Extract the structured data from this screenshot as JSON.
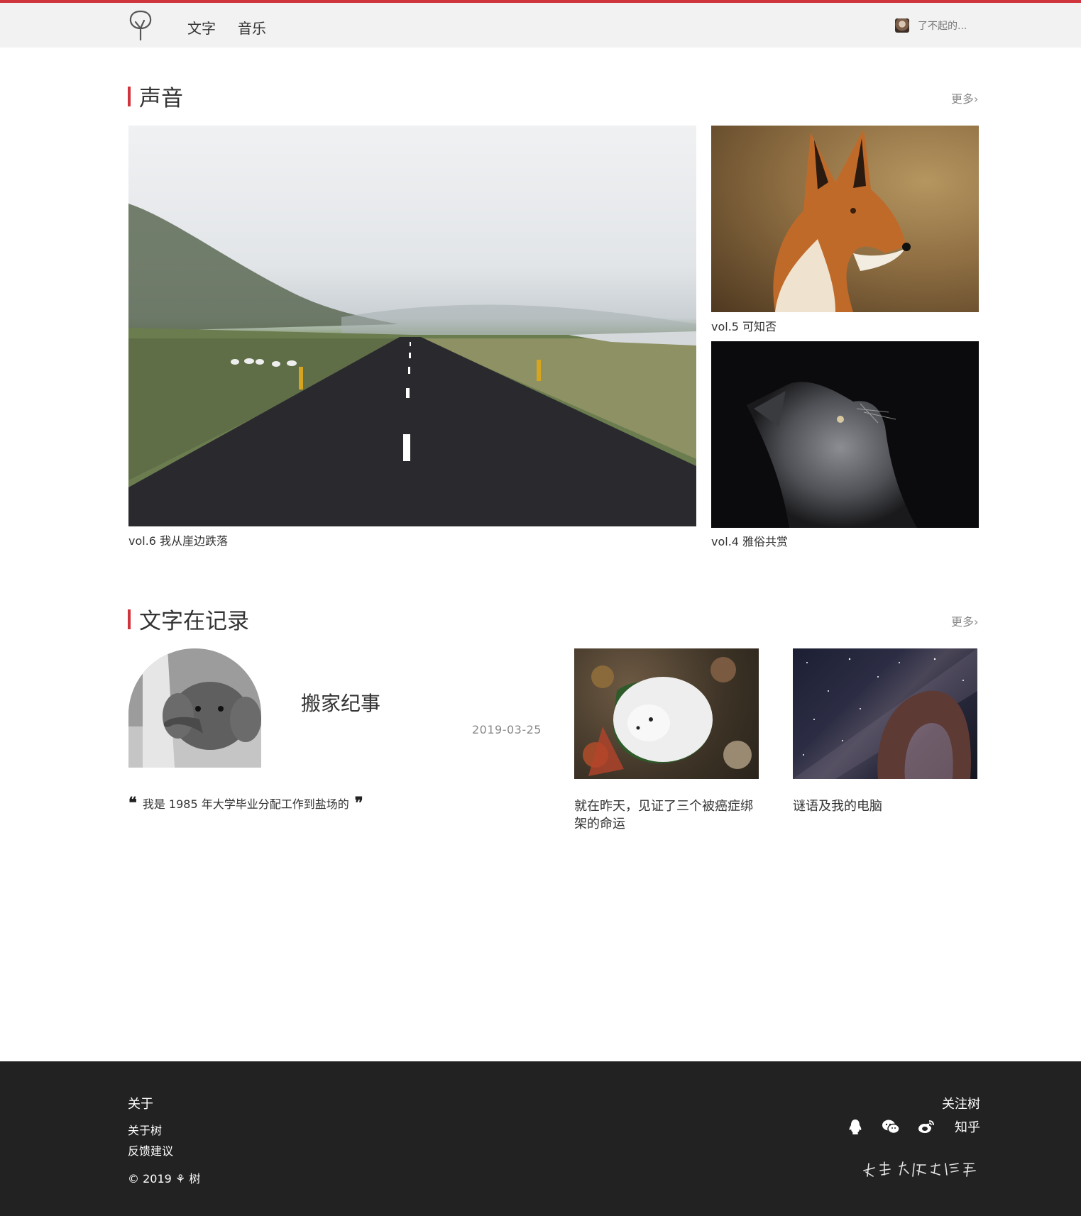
{
  "nav": {
    "logo": "tree-logo",
    "links": [
      "文字",
      "音乐"
    ],
    "user_name": "了不起的..."
  },
  "sound": {
    "title": "声音",
    "more": "更多",
    "items": [
      {
        "caption": "vol.6  我从崖边跌落",
        "image": "road-landscape"
      },
      {
        "caption": "vol.5 可知否",
        "image": "red-fox"
      },
      {
        "caption": "vol.4 雅俗共赏",
        "image": "grey-cat"
      }
    ]
  },
  "writing": {
    "title": "文字在记录",
    "more": "更多",
    "featured": {
      "title": "搬家纪事",
      "date": "2019-03-25",
      "quote": "我是 1985 年大学毕业分配工作到盐场的",
      "image": "baby-elephant"
    },
    "cards": [
      {
        "title": "就在昨天，见证了三个被癌症绑架的命运",
        "image": "white-fox"
      },
      {
        "title": "谜语及我的电脑",
        "image": "milky-way-arch"
      }
    ]
  },
  "footer": {
    "about_title": "关于",
    "about_links": [
      "关于树",
      "反馈建议"
    ],
    "copyright": "© 2019 ⚘ 树",
    "follow_title": "关注树",
    "social": [
      "qq-icon",
      "wechat-icon",
      "weibo-icon"
    ],
    "zhihu": "知乎",
    "signature": "我想为你写情书"
  },
  "colors": {
    "accent": "#d0343c",
    "topbar": "#f2f2f2",
    "footer": "#222222"
  }
}
